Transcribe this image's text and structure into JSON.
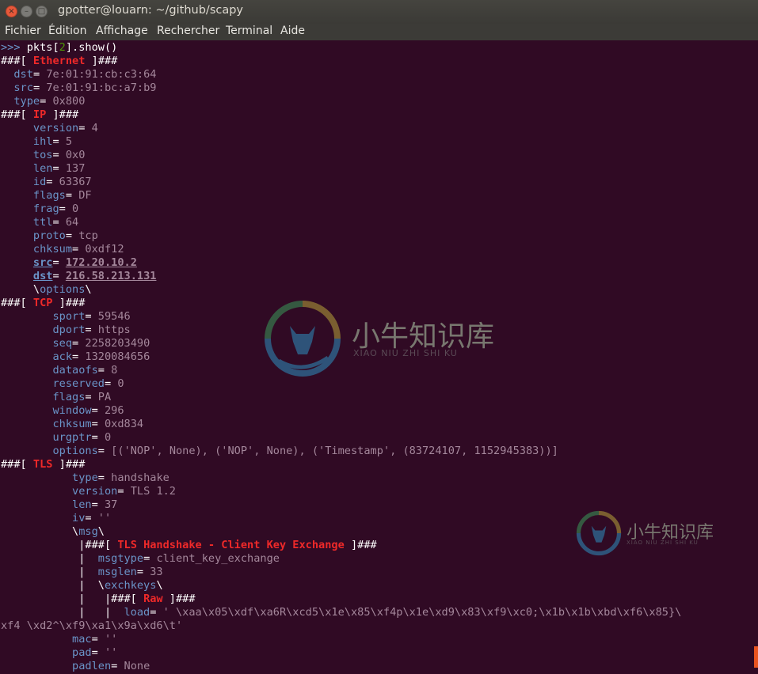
{
  "window": {
    "title": "gpotter@louarn: ~/github/scapy",
    "close_glyph": "×",
    "min_glyph": "–",
    "max_glyph": "□"
  },
  "menubar": [
    "Fichier",
    "Édition",
    "Affichage",
    "Rechercher",
    "Terminal",
    "Aide"
  ],
  "terminal": {
    "colors": {
      "background": "#300a24",
      "field": "#6a94c8",
      "value": "#a4879b",
      "layer": "#ef2929",
      "prompt_index": "#4e9a06",
      "scroll_marker": "#e95420"
    },
    "lines": [
      [
        [
          "t",
          "&gt;&gt;&gt; ",
          "f"
        ],
        [
          "t",
          "pkts["
        ],
        [
          "grn",
          "2"
        ],
        [
          "t",
          "].show()"
        ]
      ],
      [
        [
          "t",
          "###[ "
        ],
        [
          "hdr",
          "Ethernet"
        ],
        [
          "t",
          " ]###"
        ]
      ],
      [
        [
          "t",
          "  "
        ],
        [
          "f",
          "dst"
        ],
        [
          "t",
          "= "
        ],
        [
          "v",
          "7e:01:91:cb:c3:64"
        ]
      ],
      [
        [
          "t",
          "  "
        ],
        [
          "f",
          "src"
        ],
        [
          "t",
          "= "
        ],
        [
          "v",
          "7e:01:91:bc:a7:b9"
        ]
      ],
      [
        [
          "t",
          "  "
        ],
        [
          "f",
          "type"
        ],
        [
          "t",
          "= "
        ],
        [
          "v",
          "0x800"
        ]
      ],
      [
        [
          "t",
          "###[ "
        ],
        [
          "hdr",
          "IP"
        ],
        [
          "t",
          " ]###"
        ]
      ],
      [
        [
          "t",
          "     "
        ],
        [
          "f",
          "version"
        ],
        [
          "t",
          "= "
        ],
        [
          "v",
          "4"
        ]
      ],
      [
        [
          "t",
          "     "
        ],
        [
          "f",
          "ihl"
        ],
        [
          "t",
          "= "
        ],
        [
          "v",
          "5"
        ]
      ],
      [
        [
          "t",
          "     "
        ],
        [
          "f",
          "tos"
        ],
        [
          "t",
          "= "
        ],
        [
          "v",
          "0x0"
        ]
      ],
      [
        [
          "t",
          "     "
        ],
        [
          "f",
          "len"
        ],
        [
          "t",
          "= "
        ],
        [
          "v",
          "137"
        ]
      ],
      [
        [
          "t",
          "     "
        ],
        [
          "f",
          "id"
        ],
        [
          "t",
          "= "
        ],
        [
          "v",
          "63367"
        ]
      ],
      [
        [
          "t",
          "     "
        ],
        [
          "f",
          "flags"
        ],
        [
          "t",
          "= "
        ],
        [
          "v",
          "DF"
        ]
      ],
      [
        [
          "t",
          "     "
        ],
        [
          "f",
          "frag"
        ],
        [
          "t",
          "= "
        ],
        [
          "v",
          "0"
        ]
      ],
      [
        [
          "t",
          "     "
        ],
        [
          "f",
          "ttl"
        ],
        [
          "t",
          "= "
        ],
        [
          "v",
          "64"
        ]
      ],
      [
        [
          "t",
          "     "
        ],
        [
          "f",
          "proto"
        ],
        [
          "t",
          "= "
        ],
        [
          "v",
          "tcp"
        ]
      ],
      [
        [
          "t",
          "     "
        ],
        [
          "f",
          "chksum"
        ],
        [
          "t",
          "= "
        ],
        [
          "v",
          "0xdf12"
        ]
      ],
      [
        [
          "t",
          "     "
        ],
        [
          "uf",
          "src"
        ],
        [
          "t",
          "= "
        ],
        [
          "uv",
          "172.20.10.2"
        ]
      ],
      [
        [
          "t",
          "     "
        ],
        [
          "uf",
          "dst"
        ],
        [
          "t",
          "= "
        ],
        [
          "uv",
          "216.58.213.131"
        ]
      ],
      [
        [
          "t",
          "     \\"
        ],
        [
          "f",
          "options"
        ],
        [
          "t",
          "\\"
        ]
      ],
      [
        [
          "t",
          "###[ "
        ],
        [
          "hdr",
          "TCP"
        ],
        [
          "t",
          " ]###"
        ]
      ],
      [
        [
          "t",
          "        "
        ],
        [
          "f",
          "sport"
        ],
        [
          "t",
          "= "
        ],
        [
          "v",
          "59546"
        ]
      ],
      [
        [
          "t",
          "        "
        ],
        [
          "f",
          "dport"
        ],
        [
          "t",
          "= "
        ],
        [
          "v",
          "https"
        ]
      ],
      [
        [
          "t",
          "        "
        ],
        [
          "f",
          "seq"
        ],
        [
          "t",
          "= "
        ],
        [
          "v",
          "2258203490"
        ]
      ],
      [
        [
          "t",
          "        "
        ],
        [
          "f",
          "ack"
        ],
        [
          "t",
          "= "
        ],
        [
          "v",
          "1320084656"
        ]
      ],
      [
        [
          "t",
          "        "
        ],
        [
          "f",
          "dataofs"
        ],
        [
          "t",
          "= "
        ],
        [
          "v",
          "8"
        ]
      ],
      [
        [
          "t",
          "        "
        ],
        [
          "f",
          "reserved"
        ],
        [
          "t",
          "= "
        ],
        [
          "v",
          "0"
        ]
      ],
      [
        [
          "t",
          "        "
        ],
        [
          "f",
          "flags"
        ],
        [
          "t",
          "= "
        ],
        [
          "v",
          "PA"
        ]
      ],
      [
        [
          "t",
          "        "
        ],
        [
          "f",
          "window"
        ],
        [
          "t",
          "= "
        ],
        [
          "v",
          "296"
        ]
      ],
      [
        [
          "t",
          "        "
        ],
        [
          "f",
          "chksum"
        ],
        [
          "t",
          "= "
        ],
        [
          "v",
          "0xd834"
        ]
      ],
      [
        [
          "t",
          "        "
        ],
        [
          "f",
          "urgptr"
        ],
        [
          "t",
          "= "
        ],
        [
          "v",
          "0"
        ]
      ],
      [
        [
          "t",
          "        "
        ],
        [
          "f",
          "options"
        ],
        [
          "t",
          "= "
        ],
        [
          "v",
          "[('NOP', None), ('NOP', None), ('Timestamp', (83724107, 1152945383))]"
        ]
      ],
      [
        [
          "t",
          "###[ "
        ],
        [
          "hdr",
          "TLS"
        ],
        [
          "t",
          " ]###"
        ]
      ],
      [
        [
          "t",
          "           "
        ],
        [
          "f",
          "type"
        ],
        [
          "t",
          "= "
        ],
        [
          "v",
          "handshake"
        ]
      ],
      [
        [
          "t",
          "           "
        ],
        [
          "f",
          "version"
        ],
        [
          "t",
          "= "
        ],
        [
          "v",
          "TLS 1.2"
        ]
      ],
      [
        [
          "t",
          "           "
        ],
        [
          "f",
          "len"
        ],
        [
          "t",
          "= "
        ],
        [
          "v",
          "37"
        ]
      ],
      [
        [
          "t",
          "           "
        ],
        [
          "f",
          "iv"
        ],
        [
          "t",
          "= "
        ],
        [
          "v",
          "''"
        ]
      ],
      [
        [
          "t",
          "           \\"
        ],
        [
          "f",
          "msg"
        ],
        [
          "t",
          "\\"
        ]
      ],
      [
        [
          "t",
          "            |###[ "
        ],
        [
          "hdr",
          "TLS Handshake - Client Key Exchange"
        ],
        [
          "t",
          " ]###"
        ]
      ],
      [
        [
          "t",
          "            |  "
        ],
        [
          "f",
          "msgtype"
        ],
        [
          "t",
          "= "
        ],
        [
          "v",
          "client_key_exchange"
        ]
      ],
      [
        [
          "t",
          "            |  "
        ],
        [
          "f",
          "msglen"
        ],
        [
          "t",
          "= "
        ],
        [
          "v",
          "33"
        ]
      ],
      [
        [
          "t",
          "            |  \\"
        ],
        [
          "f",
          "exchkeys"
        ],
        [
          "t",
          "\\"
        ]
      ],
      [
        [
          "t",
          "            |   |###[ "
        ],
        [
          "hdr",
          "Raw"
        ],
        [
          "t",
          " ]###"
        ]
      ],
      [
        [
          "t",
          "            |   |  "
        ],
        [
          "f",
          "load"
        ],
        [
          "t",
          "= "
        ],
        [
          "v",
          "' \\xaa\\x05\\xdf\\xa6R\\xcd5\\x1e\\x85\\xf4p\\x1e\\xd9\\x83\\xf9\\xc0;\\x1b\\x1b\\xbd\\xf6\\x85}\\"
        ]
      ],
      [
        [
          "v",
          "xf4 \\xd2^\\xf9\\xa1\\x9a\\xd6\\t'"
        ]
      ],
      [
        [
          "t",
          "           "
        ],
        [
          "f",
          "mac"
        ],
        [
          "t",
          "= "
        ],
        [
          "v",
          "''"
        ]
      ],
      [
        [
          "t",
          "           "
        ],
        [
          "f",
          "pad"
        ],
        [
          "t",
          "= "
        ],
        [
          "v",
          "''"
        ]
      ],
      [
        [
          "t",
          "           "
        ],
        [
          "f",
          "padlen"
        ],
        [
          "t",
          "= "
        ],
        [
          "v",
          "None"
        ]
      ]
    ]
  },
  "watermark": {
    "title": "小牛知识库",
    "subtitle": "XIAO NIU ZHI SHI KU"
  }
}
